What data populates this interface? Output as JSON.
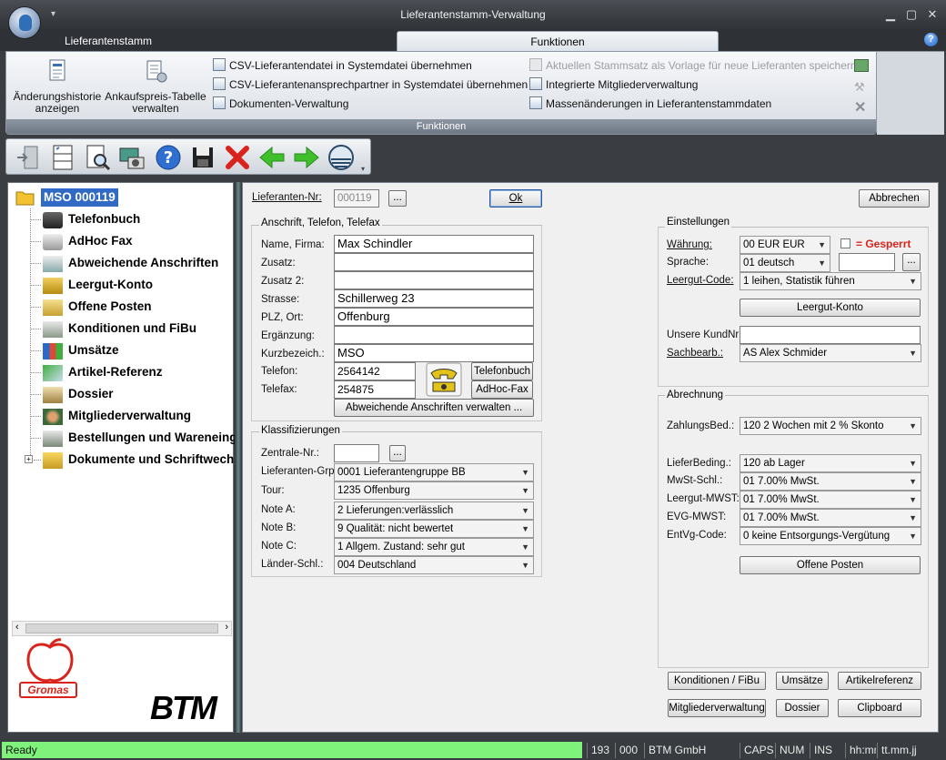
{
  "window": {
    "title": "Lieferantenstamm-Verwaltung"
  },
  "ribbon": {
    "tabs": [
      "Lieferantenstamm",
      "Funktionen"
    ],
    "big_buttons": [
      {
        "line1": "Änderungshistorie",
        "line2": "anzeigen"
      },
      {
        "line1": "Ankaufspreis-Tabelle",
        "line2": "verwalten"
      }
    ],
    "items_col1": [
      "CSV-Lieferantendatei in Systemdatei übernehmen",
      "CSV-Lieferantenansprechpartner in Systemdatei übernehmen",
      "Dokumenten-Verwaltung"
    ],
    "items_col2": [
      "Aktuellen Stammsatz als Vorlage für neue Lieferanten speichern",
      "Integrierte Mitgliederverwaltung",
      "Massenänderungen in Lieferantenstammdaten"
    ],
    "group_label": "Funktionen"
  },
  "tree": {
    "root": "MSO 000119",
    "items": [
      "Telefonbuch",
      "AdHoc Fax",
      "Abweichende Anschriften",
      "Leergut-Konto",
      "Offene Posten",
      "Konditionen und FiBu",
      "Umsätze",
      "Artikel-Referenz",
      "Dossier",
      "Mitgliederverwaltung",
      "Bestellungen und Wareneingang",
      "Dokumente und Schriftwechsel"
    ],
    "logo_left": "Gromas",
    "logo_right": "BTM"
  },
  "form": {
    "lieferanten_nr_label": "Lieferanten-Nr:",
    "lieferanten_nr": "000119",
    "ok": "Ok",
    "abbrechen": "Abbrechen",
    "browse": "...",
    "anschrift": {
      "title": "Anschrift, Telefon, Telefax",
      "labels": [
        "Name, Firma:",
        "Zusatz:",
        "Zusatz 2:",
        "Strasse:",
        "PLZ, Ort:",
        "Ergänzung:",
        "Kurzbezeich.:",
        "Telefon:",
        "Telefax:"
      ],
      "values": [
        "Max Schindler",
        "",
        "",
        "Schillerweg 23",
        "Offenburg",
        "",
        "MSO",
        "2564142",
        "254875"
      ],
      "telefonbuch": "Telefonbuch",
      "adhocfax": "AdHoc-Fax",
      "abweichende": "Abweichende Anschriften verwalten ..."
    },
    "klass": {
      "title": "Klassifizierungen",
      "zentrale_label": "Zentrale-Nr.:",
      "zentrale_value": "",
      "labels": [
        "Lieferanten-Grp.:",
        "Tour:",
        "Note A:",
        "Note B:",
        "Note C:",
        "Länder-Schl.:"
      ],
      "values": [
        "0001 Lieferantengruppe BB",
        "1235 Offenburg",
        "2 Lieferungen:verlässlich",
        "9 Qualität: nicht bewertet",
        "1 Allgem. Zustand: sehr gut",
        "004 Deutschland"
      ]
    },
    "einstellungen": {
      "title": "Einstellungen",
      "waehrung_label": "Währung:",
      "waehrung": "00 EUR EUR",
      "gesperrt": "= Gesperrt",
      "sprache_label": "Sprache:",
      "sprache": "01 deutsch",
      "leergut_code_label": "Leergut-Code:",
      "leergut_code": "1 leihen, Statistik führen",
      "leergut_konto": "Leergut-Konto",
      "kundnr_label": "Unsere KundNr:",
      "kundnr": "",
      "sachbearb_label": "Sachbearb.:",
      "sachbearb": "AS Alex Schmider"
    },
    "abrechnung": {
      "title": "Abrechnung",
      "zahlungsbed_label": "ZahlungsBed.:",
      "zahlungsbed": "120 2 Wochen mit  2 % Skonto",
      "labels": [
        "LieferBeding.:",
        "MwSt-Schl.:",
        "Leergut-MWST:",
        "EVG-MWST:",
        "EntVg-Code:"
      ],
      "values": [
        "120 ab Lager",
        "01  7.00% MwSt.",
        "01  7.00% MwSt.",
        "01  7.00% MwSt.",
        "0 keine Entsorgungs-Vergütung"
      ],
      "offene_posten": "Offene Posten"
    },
    "bottom_buttons": [
      "Konditionen / FiBu",
      "Umsätze",
      "Artikelreferenz",
      "Mitgliederverwaltung",
      "Dossier",
      "Clipboard"
    ]
  },
  "statusbar": {
    "ready": "Ready",
    "fields": [
      "193",
      "000",
      "BTM GmbH",
      "CAPS",
      "NUM",
      "INS",
      "hh:mm",
      "tt.mm.jj"
    ]
  }
}
